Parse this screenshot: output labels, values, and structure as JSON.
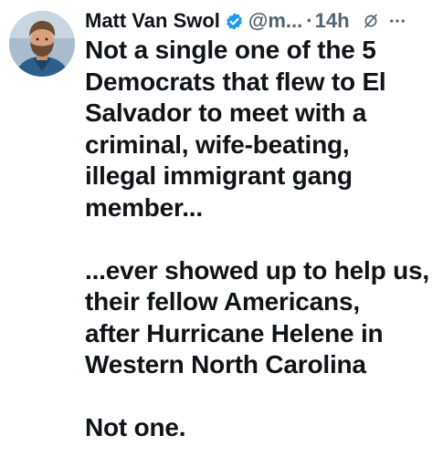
{
  "post": {
    "author": {
      "display_name": "Matt Van Swol",
      "verified": true,
      "handle": "@m...",
      "separator": "·",
      "time": "14h"
    },
    "icons": {
      "verified": "verified-badge-icon",
      "grok": "grok-icon",
      "more": "more-options-icon"
    },
    "colors": {
      "text": "#0f1419",
      "secondary": "#536471",
      "verified": "#1d9bf0"
    },
    "paragraphs": [
      [
        "Not a single one of the 5",
        "Democrats that flew to El",
        "Salvador to meet with a",
        "criminal, wife-beating,",
        "illegal immigrant gang",
        "member..."
      ],
      [
        "...ever showed up to help us,",
        "their fellow Americans,",
        "after Hurricane Helene in",
        "Western North Carolina"
      ],
      [
        "Not one."
      ]
    ]
  }
}
